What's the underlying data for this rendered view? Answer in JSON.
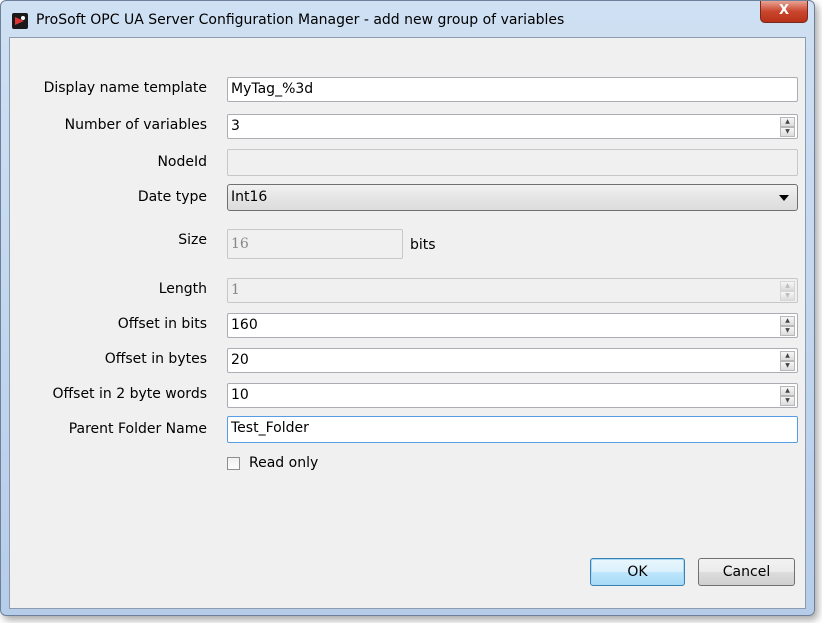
{
  "window": {
    "title": "ProSoft OPC UA Server Configuration Manager - add new group of variables",
    "close_label": "X"
  },
  "form": {
    "display_name_template": {
      "label": "Display name template",
      "value": "MyTag_%3d"
    },
    "number_of_variables": {
      "label": "Number of variables",
      "value": "3"
    },
    "node_id": {
      "label": "NodeId",
      "value": ""
    },
    "data_type": {
      "label": "Date type",
      "value": "Int16"
    },
    "size": {
      "label": "Size",
      "value": "16",
      "unit": "bits"
    },
    "length": {
      "label": "Length",
      "value": "1"
    },
    "offset_bits": {
      "label": "Offset in bits",
      "value": "160"
    },
    "offset_bytes": {
      "label": "Offset in bytes",
      "value": "20"
    },
    "offset_words": {
      "label": "Offset in 2 byte words",
      "value": "10"
    },
    "parent_folder": {
      "label": "Parent Folder Name",
      "value": "Test_Folder"
    },
    "read_only": {
      "label": "Read only",
      "checked": false
    }
  },
  "buttons": {
    "ok": "OK",
    "cancel": "Cancel"
  }
}
